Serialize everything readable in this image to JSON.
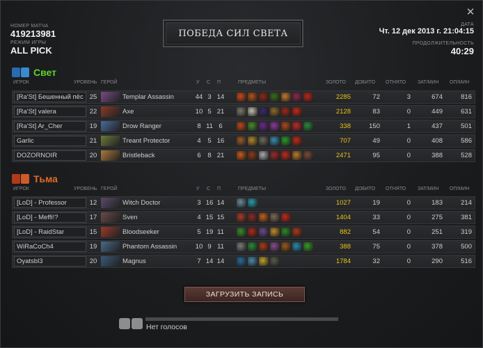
{
  "match": {
    "id_label": "НОМЕР МАТЧА",
    "id_value": "419213981",
    "mode_label": "РЕЖИМ ИГРЫ",
    "mode_value": "ALL PICK",
    "title": "ПОБЕДА СИЛ СВЕТА",
    "date_label": "ДАТА",
    "date_value": "Чт. 12 дек 2013 г. 21:04:15",
    "duration_label": "ПРОДОЛЖИТЕЛЬНОСТЬ",
    "duration_value": "40:29"
  },
  "columns": {
    "player": "ИГРОК",
    "level": "УРОВЕНЬ",
    "hero": "ГЕРОЙ",
    "k": "У",
    "d": "С",
    "a": "П",
    "items": "ПРЕДМЕТЫ",
    "gold": "ЗОЛОТО",
    "lh": "ДОБИТО",
    "dn": "ОТНЯТО",
    "gpm": "ЗАТ/МИН",
    "xpm": "ОП/МИН"
  },
  "radiant": {
    "name": "Свет",
    "color": "#5fd22b",
    "players": [
      {
        "player": "[Ra'St] Бешенный пёс",
        "level": "25",
        "hero": "Templar Assassin",
        "k": "44",
        "d": "3",
        "a": "14",
        "gold": "2285",
        "lh": "72",
        "dn": "3",
        "gpm": "674",
        "xpm": "816",
        "portrait": "#7a4a86",
        "items": [
          "#c84a1c",
          "#b3541a",
          "#8a2a18",
          "#3a6a1c",
          "#c07a2a",
          "#8a2a4a",
          "#b8281a"
        ]
      },
      {
        "player": "[Ra'St] valera",
        "level": "22",
        "hero": "Axe",
        "k": "10",
        "d": "5",
        "a": "21",
        "gold": "2128",
        "lh": "83",
        "dn": "0",
        "gpm": "449",
        "xpm": "631",
        "portrait": "#8a3a2a",
        "items": [
          "#7a7a6a",
          "#c0c0b0",
          "#3a2a6a",
          "#8a6a2a",
          "#9a2a1a",
          "#c02a1a"
        ]
      },
      {
        "player": "[Ra'St] Ar_Cher",
        "level": "19",
        "hero": "Drow Ranger",
        "k": "8",
        "d": "11",
        "a": "6",
        "gold": "338",
        "lh": "150",
        "dn": "1",
        "gpm": "437",
        "xpm": "501",
        "portrait": "#4a6a9a",
        "items": [
          "#b84a1a",
          "#4a8a2a",
          "#6a2a8a",
          "#8a3a9a",
          "#aa4a1a",
          "#c02a2a",
          "#2a8a3a"
        ]
      },
      {
        "player": "Garlic",
        "level": "21",
        "hero": "Treant Protector",
        "k": "4",
        "d": "5",
        "a": "16",
        "gold": "707",
        "lh": "49",
        "dn": "0",
        "gpm": "408",
        "xpm": "586",
        "portrait": "#6a7a3a",
        "items": [
          "#9a5a2a",
          "#b0882a",
          "#6a6a5a",
          "#3a8aaa",
          "#2a9a2a",
          "#c02a1a"
        ]
      },
      {
        "player": "DOZORNOIR",
        "level": "20",
        "hero": "Bristleback",
        "k": "6",
        "d": "8",
        "a": "21",
        "gold": "2471",
        "lh": "95",
        "dn": "0",
        "gpm": "388",
        "xpm": "528",
        "portrait": "#aa7a3a",
        "items": [
          "#c85a1a",
          "#8a3a1a",
          "#aaaaaa",
          "#9a2a2a",
          "#c02a1a",
          "#b87a2a",
          "#7a4a3a"
        ]
      }
    ]
  },
  "dire": {
    "name": "Тьма",
    "color": "#e06a2a",
    "players": [
      {
        "player": "[LoD] - Professor",
        "level": "12",
        "hero": "Witch Doctor",
        "k": "3",
        "d": "16",
        "a": "14",
        "gold": "1027",
        "lh": "19",
        "dn": "0",
        "gpm": "183",
        "xpm": "214",
        "portrait": "#5a4a6a",
        "items": [
          "#6a8a9a",
          "#2a9aaa"
        ]
      },
      {
        "player": "[LoD] - Meffi!?",
        "level": "17",
        "hero": "Sven",
        "k": "4",
        "d": "15",
        "a": "15",
        "gold": "1404",
        "lh": "33",
        "dn": "0",
        "gpm": "275",
        "xpm": "381",
        "portrait": "#6a4a4a",
        "items": [
          "#aa3a2a",
          "#8a2a2a",
          "#c0601a",
          "#7a6a5a",
          "#c02a1a"
        ]
      },
      {
        "player": "[LoD] - RaidStar",
        "level": "15",
        "hero": "Bloodseeker",
        "k": "5",
        "d": "19",
        "a": "11",
        "gold": "882",
        "lh": "54",
        "dn": "0",
        "gpm": "251",
        "xpm": "319",
        "portrait": "#9a3a2a",
        "items": [
          "#3a8a2a",
          "#aa2a1a",
          "#6a4a8a",
          "#c08a2a",
          "#2a8a2a",
          "#aa3a1a"
        ]
      },
      {
        "player": "WiRaCoCh4",
        "level": "19",
        "hero": "Phantom Assassin",
        "k": "10",
        "d": "9",
        "a": "11",
        "gold": "388",
        "lh": "75",
        "dn": "0",
        "gpm": "378",
        "xpm": "500",
        "portrait": "#4a6a8a",
        "items": [
          "#7a7a7a",
          "#2a8a3a",
          "#aa3a1a",
          "#8a4a8a",
          "#9a5a1a",
          "#2a8aaa",
          "#3a9a2a"
        ]
      },
      {
        "player": "Oyatsbl3",
        "level": "20",
        "hero": "Magnus",
        "k": "7",
        "d": "14",
        "a": "14",
        "gold": "1784",
        "lh": "32",
        "dn": "0",
        "gpm": "290",
        "xpm": "516",
        "portrait": "#3a5a7a",
        "items": [
          "#2a6a9a",
          "#4a8aaa",
          "#c0a02a",
          "#5a5a4a"
        ]
      }
    ]
  },
  "replay_button": "ЗАГРУЗИТЬ ЗАПИСЬ",
  "votes_text": "Нет голосов"
}
